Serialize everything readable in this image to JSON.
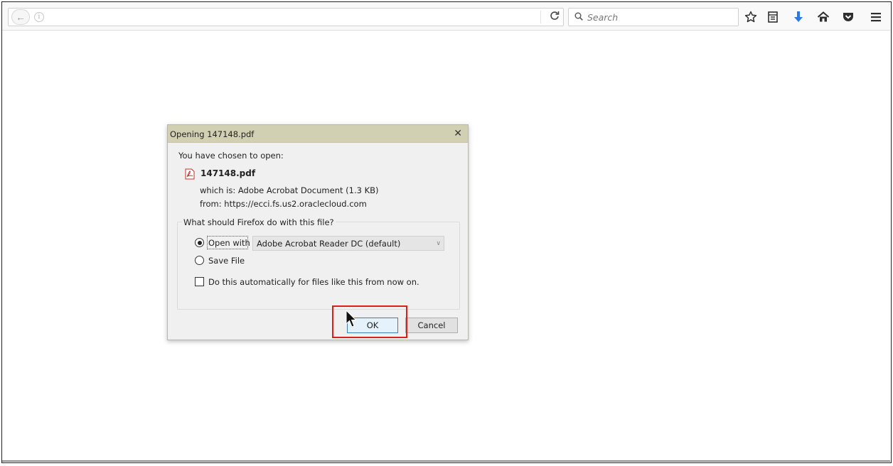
{
  "browser": {
    "back_glyph": "←",
    "info_glyph": "i",
    "reload_glyph": "C",
    "search_placeholder": "Search",
    "icons": [
      "back-arrow-icon",
      "site-info-icon",
      "reload-icon",
      "search-icon",
      "bookmark-star-icon",
      "reading-list-icon",
      "downloads-icon",
      "home-icon",
      "pocket-icon",
      "menu-icon"
    ]
  },
  "dialog": {
    "title": "Opening 147148.pdf",
    "close_glyph": "✕",
    "intro": "You have chosen to open:",
    "file_name": "147148.pdf",
    "which_is": "which is:  Adobe Acrobat Document (1.3 KB)",
    "from": "from:  https://ecci.fs.us2.oraclecloud.com",
    "question": "What should Firefox do with this file?",
    "open_with_label": "Open with",
    "open_with_value": "Adobe Acrobat Reader DC  (default)",
    "open_with_selected": true,
    "save_file_label": "Save File",
    "auto_label": "Do this automatically for files like this from now on.",
    "auto_checked": false,
    "ok_label": "OK",
    "cancel_label": "Cancel"
  },
  "colors": {
    "title_bar": "#d2d0b2",
    "highlight_box": "#d9201d",
    "downloads_icon": "#2a7ae2",
    "ok_border": "#3c7fb1"
  }
}
